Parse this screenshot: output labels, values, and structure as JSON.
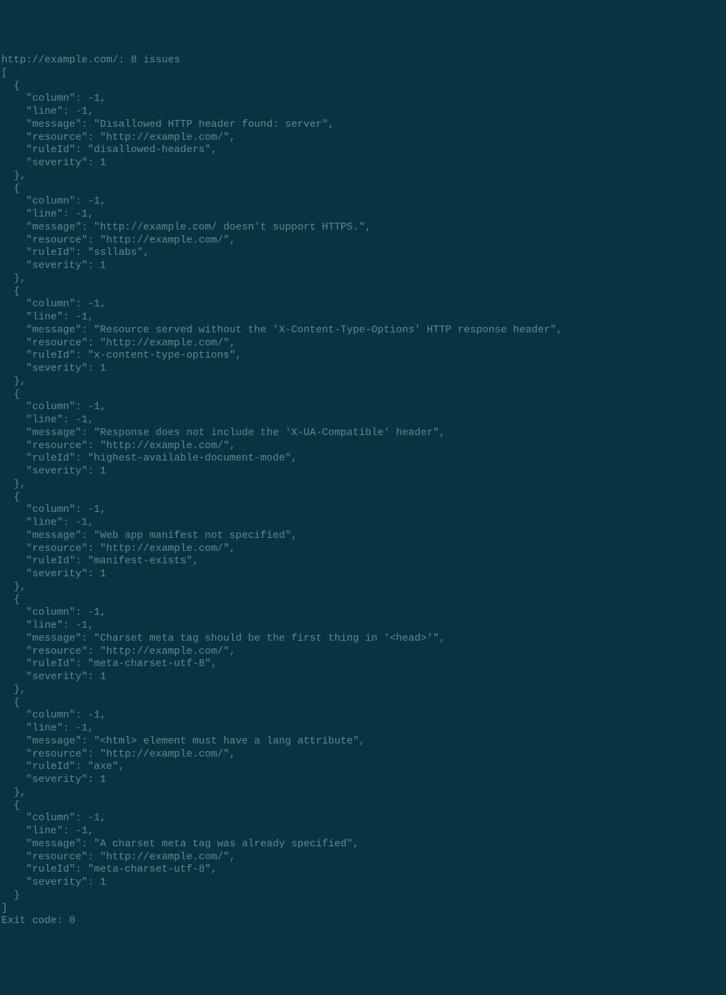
{
  "terminal": {
    "header": {
      "url": "http://example.com/",
      "issue_count": 8,
      "issue_label": "issues"
    },
    "issues": [
      {
        "column": -1,
        "line": -1,
        "message": "Disallowed HTTP header found: server",
        "resource": "http://example.com/",
        "ruleId": "disallowed-headers",
        "severity": 1
      },
      {
        "column": -1,
        "line": -1,
        "message": "http://example.com/ doesn't support HTTPS.",
        "resource": "http://example.com/",
        "ruleId": "ssllabs",
        "severity": 1
      },
      {
        "column": -1,
        "line": -1,
        "message": "Resource served without the 'X-Content-Type-Options' HTTP response header",
        "resource": "http://example.com/",
        "ruleId": "x-content-type-options",
        "severity": 1
      },
      {
        "column": -1,
        "line": -1,
        "message": "Response does not include the 'X-UA-Compatible' header",
        "resource": "http://example.com/",
        "ruleId": "highest-available-document-mode",
        "severity": 1
      },
      {
        "column": -1,
        "line": -1,
        "message": "Web app manifest not specified",
        "resource": "http://example.com/",
        "ruleId": "manifest-exists",
        "severity": 1
      },
      {
        "column": -1,
        "line": -1,
        "message": "Charset meta tag should be the first thing in '<head>'",
        "resource": "http://example.com/",
        "ruleId": "meta-charset-utf-8",
        "severity": 1
      },
      {
        "column": -1,
        "line": -1,
        "message": "<html> element must have a lang attribute",
        "resource": "http://example.com/",
        "ruleId": "axe",
        "severity": 1
      },
      {
        "column": -1,
        "line": -1,
        "message": "A charset meta tag was already specified",
        "resource": "http://example.com/",
        "ruleId": "meta-charset-utf-8",
        "severity": 1
      }
    ],
    "footer": {
      "exit_label": "Exit code",
      "exit_code": 0
    }
  }
}
